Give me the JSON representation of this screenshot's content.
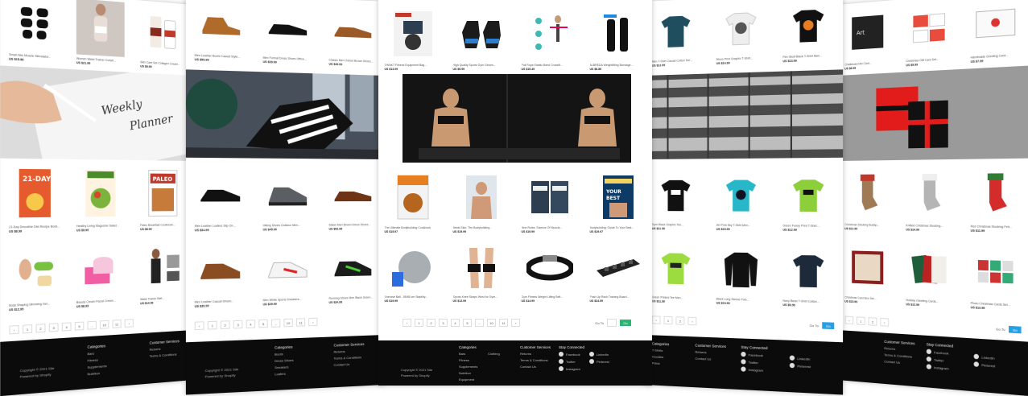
{
  "center": {
    "top_products": [
      {
        "caption": "THINKT Fitness Equipment Bag...",
        "price": "US $14.99"
      },
      {
        "caption": "High Quality Sports Gym Gloves...",
        "price": "US $9.99"
      },
      {
        "caption": "Pull Rope Elastic Band Crossfit...",
        "price": "US $15.49"
      },
      {
        "caption": "ALBREDA Weightlifting Bandage...",
        "price": "US $6.86"
      }
    ],
    "bottom_products_1": [
      {
        "caption": "The Ultimate Bodybuilding Cookbook",
        "price": "US $15.97"
      },
      {
        "caption": "Beast Skin: The Bodybuilding...",
        "price": "US $19.99"
      },
      {
        "caption": "New Rules: Science Of Muscle...",
        "price": "US $19.99"
      },
      {
        "caption": "Bodybuilding: Guide To Your Best...",
        "price": "US $19.97"
      }
    ],
    "bottom_products_2": [
      {
        "caption": "Exercise Ball - 55/65 cm Stability...",
        "price": "US $19.99"
      },
      {
        "caption": "Sports Knee Straps Wrist for Gym...",
        "price": "US $12.99"
      },
      {
        "caption": "Gym Fitness Weight Lifting Belt...",
        "price": "US $14.99"
      },
      {
        "caption": "Push Up Rack Training Board...",
        "price": "US $24.99"
      }
    ],
    "pagination": {
      "prev": "‹",
      "pages": [
        "1",
        "2",
        "3",
        "4",
        "5",
        "...",
        "10",
        "11"
      ],
      "next": "›",
      "goto_label": "Go To",
      "go_button": "Go"
    },
    "footer": {
      "col1_head": "Categories",
      "col1_items": [
        "Bars",
        "Fitness",
        "Supplements",
        "Nutrition",
        "Equipment"
      ],
      "col1b_items": [
        "Clothing"
      ],
      "col2_head": "Customer Services",
      "col2_items": [
        "Returns",
        "Terms & Conditions",
        "Contact Us"
      ],
      "col3_head": "Stay Connected",
      "col3_items": [
        "Facebook",
        "Twitter",
        "Instagram"
      ],
      "col3b_items": [
        "LinkedIn",
        "Pinterest"
      ],
      "copyright": "Copyright © 2021 Site",
      "powered": "Powered by Shopify"
    }
  },
  "left1": {
    "top_products": [
      {
        "caption": "Smart Abs Muscle Stimulator...",
        "price": "US $15.98"
      },
      {
        "caption": "Women Waist Trainer Corset...",
        "price": "US $21.95"
      },
      {
        "caption": "Skin Care Set Collagen Cream...",
        "price": "US $9.99"
      }
    ],
    "products_a": [
      {
        "caption": "21-Day Smoothie Diet Recipe Book...",
        "price": "US $8.99"
      },
      {
        "caption": "Healthy Living Magazine Salad...",
        "price": "US $9.99"
      },
      {
        "caption": "Paleo Breakfast Cookbook...",
        "price": "US $8.99"
      }
    ],
    "products_b": [
      {
        "caption": "Body Shaping Slimming Gel...",
        "price": "US $12.95"
      },
      {
        "caption": "Beauty Cream Facial Cream...",
        "price": "US $8.99"
      },
      {
        "caption": "Waist Trainer Belt...",
        "price": "US $14.99"
      }
    ],
    "pagination": {
      "prev": "‹",
      "pages": [
        "1",
        "2",
        "3",
        "4",
        "5",
        "...",
        "10",
        "11"
      ],
      "next": "›"
    },
    "footer": {
      "col1_head": "Categories",
      "col1_items": [
        "Bars",
        "Fitness",
        "Supplements",
        "Nutrition"
      ],
      "col2_head": "Customer Services",
      "col2_items": [
        "Returns",
        "Terms & Conditions"
      ],
      "copyright": "Copyright © 2021 Site",
      "powered": "Powered by Shopify"
    }
  },
  "left2": {
    "top_products": [
      {
        "caption": "Men Leather Boots Casual Style...",
        "price": "US $59.99"
      },
      {
        "caption": "Men Formal Dress Shoes Office...",
        "price": "US $39.99"
      },
      {
        "caption": "Classic Men Oxford Brown Shoes...",
        "price": "US $49.99"
      }
    ],
    "products_a": [
      {
        "caption": "Men Leather Loafers Slip On...",
        "price": "US $34.99"
      },
      {
        "caption": "Hiking Shoes Outdoor Men...",
        "price": "US $45.99"
      },
      {
        "caption": "Italian Men Brown Dress Shoes...",
        "price": "US $52.99"
      }
    ],
    "products_b": [
      {
        "caption": "Men Leather Casual Shoes...",
        "price": "US $39.99"
      },
      {
        "caption": "Men White Sports Sneakers...",
        "price": "US $29.99"
      },
      {
        "caption": "Running Shoes Men Black Green...",
        "price": "US $34.99"
      }
    ],
    "pagination": {
      "prev": "‹",
      "pages": [
        "1",
        "2",
        "3",
        "4",
        "5",
        "...",
        "10",
        "11"
      ],
      "next": "›"
    },
    "footer": {
      "col1_head": "Categories",
      "col1_items": [
        "Boots",
        "Dress Shoes",
        "Sneakers",
        "Loafers"
      ],
      "col2_head": "Customer Services",
      "col2_items": [
        "Returns",
        "Terms & Conditions",
        "Contact Us"
      ],
      "copyright": "Copyright © 2021 Site",
      "powered": "Powered by Shopify"
    }
  },
  "right1": {
    "top_products": [
      {
        "caption": "Men T-Shirt Casual Cotton Tee...",
        "price": "US $12.99"
      },
      {
        "caption": "Moon Print Graphic T-Shirt...",
        "price": "US $14.99"
      },
      {
        "caption": "Fire Skull Black T-Shirt Men...",
        "price": "US $13.99"
      }
    ],
    "products_a": [
      {
        "caption": "Gym Black Graphic Tee...",
        "price": "US $11.99"
      },
      {
        "caption": "3D Print Sky T-Shirt Men...",
        "price": "US $15.99"
      },
      {
        "caption": "Green Funny Print T-Shirt...",
        "price": "US $12.99"
      }
    ],
    "products_b": [
      {
        "caption": "Green Printed Tee Men...",
        "price": "US $11.99"
      },
      {
        "caption": "Black Long Sleeve Polo...",
        "price": "US $19.99"
      },
      {
        "caption": "Navy Basic T-Shirt Cotton...",
        "price": "US $9.99"
      }
    ],
    "pagination": {
      "prev": "‹",
      "pages": [
        "1",
        "2",
        "3",
        "4",
        "5",
        "...",
        "10",
        "11"
      ],
      "next": "›",
      "goto_label": "Go To",
      "go_button": "Go"
    },
    "footer": {
      "col1_head": "Categories",
      "col1_items": [
        "T-Shirts",
        "Hoodies",
        "Polos"
      ],
      "col2_head": "Customer Services",
      "col2_items": [
        "Returns",
        "Contact Us"
      ],
      "col3_head": "Stay Connected",
      "col3_items": [
        "Facebook",
        "Twitter",
        "Instagram"
      ],
      "col3b_items": [
        "LinkedIn",
        "Pinterest"
      ]
    }
  },
  "right2": {
    "top_products": [
      {
        "caption": "Chalkboard Art Card...",
        "price": "US $8.99"
      },
      {
        "caption": "Christmas Gift Card Set...",
        "price": "US $9.99"
      },
      {
        "caption": "Handmade Greeting Card...",
        "price": "US $7.99"
      }
    ],
    "products_a": [
      {
        "caption": "Christmas Stocking Burlap...",
        "price": "US $12.99"
      },
      {
        "caption": "Knitted Christmas Stocking...",
        "price": "US $14.99"
      },
      {
        "caption": "Red Christmas Stocking Felt...",
        "price": "US $11.99"
      }
    ],
    "products_b": [
      {
        "caption": "Christmas Card Box Set...",
        "price": "US $15.99"
      },
      {
        "caption": "Holiday Greeting Cards...",
        "price": "US $12.99"
      },
      {
        "caption": "Photo Christmas Cards Set...",
        "price": "US $13.99"
      }
    ],
    "pagination": {
      "prev": "‹",
      "pages": [
        "1",
        "2",
        "3",
        "4",
        "5",
        "...",
        "10",
        "11"
      ],
      "next": "›",
      "goto_label": "Go To",
      "go_button": "Go"
    },
    "footer": {
      "col2_head": "Customer Services",
      "col2_items": [
        "Returns",
        "Terms & Conditions",
        "Contact Us"
      ],
      "col3_head": "Stay Connected",
      "col3_items": [
        "Facebook",
        "Twitter",
        "Instagram"
      ],
      "col3b_items": [
        "LinkedIn",
        "Pinterest"
      ]
    }
  },
  "colors": {
    "go_button": "#25a0e6",
    "footer_bg": "#0b0b0b",
    "page_bg": "#ffffff"
  }
}
